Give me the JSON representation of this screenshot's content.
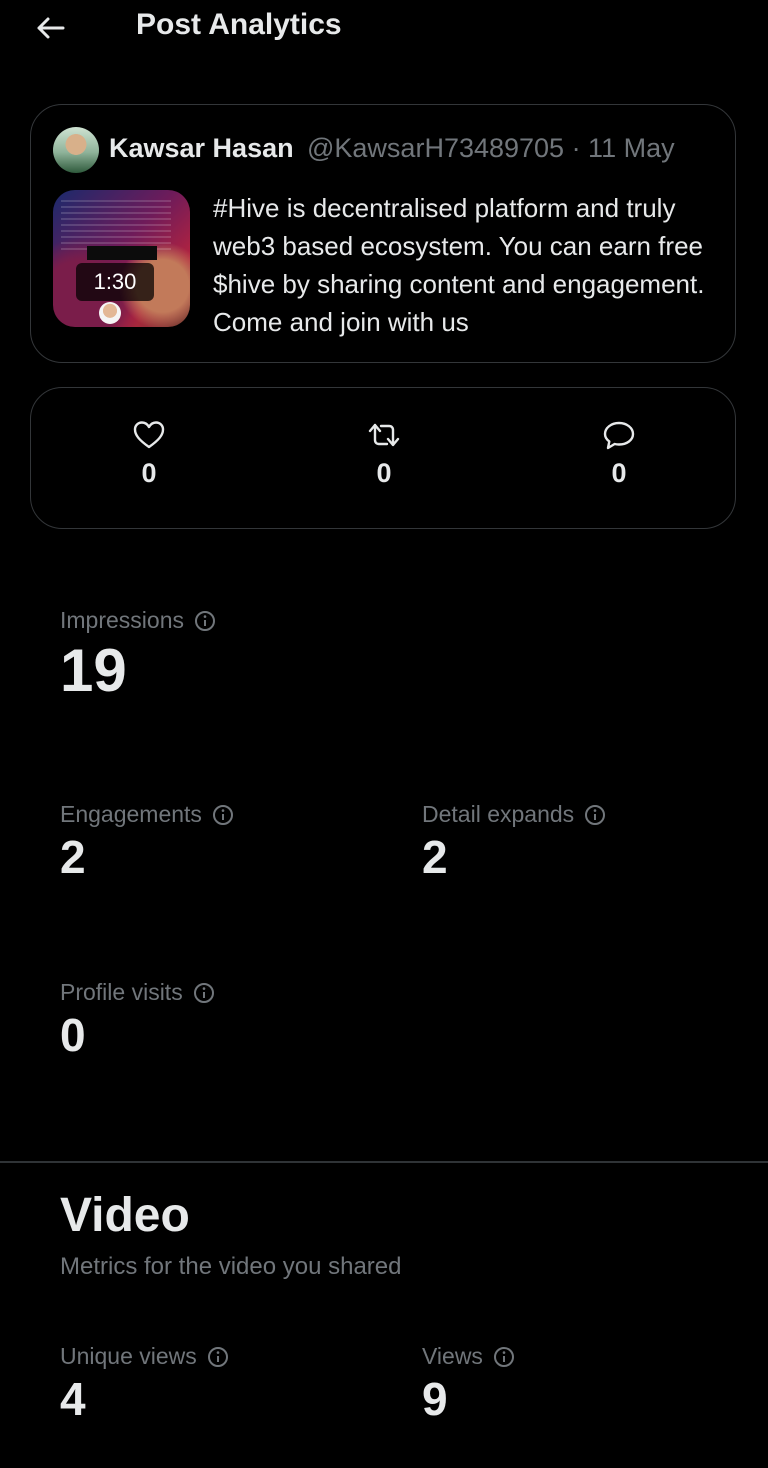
{
  "header": {
    "title": "Post Analytics"
  },
  "post": {
    "author_name": "Kawsar Hasan",
    "author_handle_date": "@KawsarH73489705 · 11 May",
    "video_duration": "1:30",
    "text": "#Hive is decentralised platform and truly web3 based ecosystem. You can earn free $hive by sharing content and engagement. Come and join with us"
  },
  "engagement": {
    "likes": "0",
    "reposts": "0",
    "replies": "0"
  },
  "metrics": {
    "impressions": {
      "label": "Impressions",
      "value": "19"
    },
    "engagements": {
      "label": "Engagements",
      "value": "2"
    },
    "detail_expands": {
      "label": "Detail expands",
      "value": "2"
    },
    "profile_visits": {
      "label": "Profile visits",
      "value": "0"
    }
  },
  "video": {
    "title": "Video",
    "subtitle": "Metrics for the video you shared",
    "unique_views": {
      "label": "Unique views",
      "value": "4"
    },
    "views": {
      "label": "Views",
      "value": "9"
    }
  },
  "colors": {
    "background": "#000000",
    "text_primary": "#e7e9ea",
    "text_secondary": "#71767b",
    "border": "#333639"
  }
}
